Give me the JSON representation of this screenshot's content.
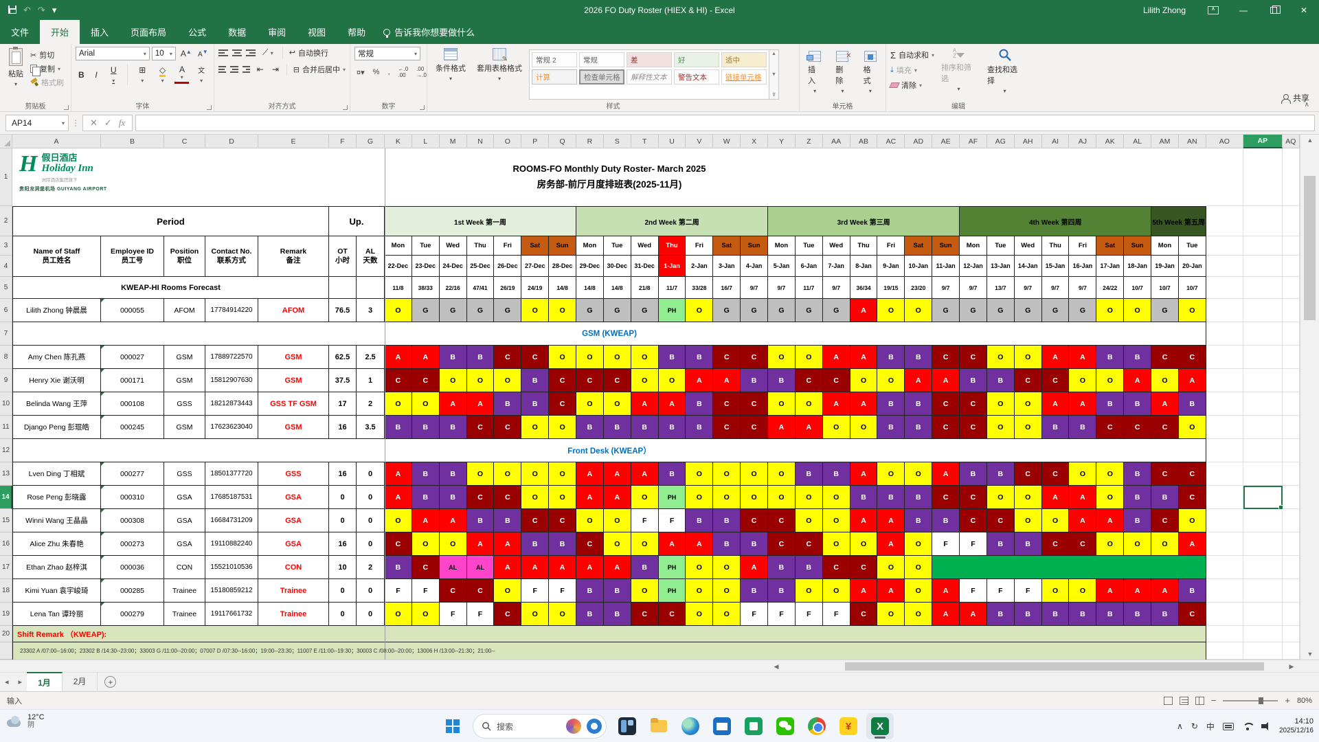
{
  "titlebar": {
    "title": "2026 FO Duty Roster (HIEX & HI)  -  Excel",
    "user": "Lilith Zhong"
  },
  "ribbon": {
    "file_tab": "文件",
    "tabs": [
      "开始",
      "插入",
      "页面布局",
      "公式",
      "数据",
      "审阅",
      "视图",
      "帮助"
    ],
    "active_tab": "开始",
    "tell_me": "告诉我你想要做什么",
    "share": "共享",
    "clipboard": {
      "label": "剪贴板",
      "paste": "粘贴",
      "cut": "剪切",
      "copy": "复制",
      "painter": "格式刷"
    },
    "font": {
      "label": "字体",
      "family": "Arial",
      "size": "10",
      "pinyin": "文"
    },
    "alignment": {
      "label": "对齐方式",
      "wrap": "自动换行",
      "merge": "合并后居中"
    },
    "number": {
      "label": "数字",
      "format": "常规"
    },
    "styles": {
      "label": "样式",
      "conditional": "条件格式",
      "format_table": "套用表格格式",
      "gallery": [
        "常规 2",
        "常规",
        "差",
        "好",
        "适中",
        "计算",
        "检查单元格",
        "解释性文本",
        "警告文本",
        "链接单元格"
      ]
    },
    "cells": {
      "label": "单元格",
      "insert": "插入",
      "delete": "删除",
      "format": "格式"
    },
    "editing": {
      "label": "编辑",
      "autosum": "自动求和",
      "fill": "填充",
      "clear": "清除",
      "sort": "排序和筛选",
      "find": "查找和选择"
    }
  },
  "formula_bar": {
    "name_box": "AP14",
    "formula": ""
  },
  "sheet": {
    "columns": [
      "A",
      "B",
      "C",
      "D",
      "E",
      "F",
      "G",
      "K",
      "L",
      "M",
      "N",
      "O",
      "P",
      "Q",
      "R",
      "S",
      "T",
      "U",
      "V",
      "W",
      "X",
      "Y",
      "Z",
      "AA",
      "AB",
      "AC",
      "AD",
      "AE",
      "AF",
      "AG",
      "AH",
      "AI",
      "AJ",
      "AK",
      "AL",
      "AM",
      "AN",
      "AO",
      "AP",
      "AQ"
    ],
    "selected_column": "AP",
    "selected_row": 14,
    "visible_rows": 20,
    "tabs": [
      "1月",
      "2月"
    ],
    "active_tab": "1月",
    "status_mode": "输入",
    "zoom": "80%"
  },
  "logo": {
    "mark": "H",
    "cn": "假日酒店",
    "en": "Holiday Inn",
    "sub": "洲际酒店集团旗下",
    "airport": "贵阳龙洞堡机场",
    "airport_en": "GUIYANG AIRPORT",
    "color": "#008c5a"
  },
  "roster": {
    "title_en": "ROOMS-FO Monthly Duty Roster- March 2025",
    "title_cn": "房务部-前厅月度排班表(2025-11月)",
    "period": "Period",
    "up": "Up.",
    "col_headers": [
      [
        "Name of Staff",
        "员工姓名"
      ],
      [
        "Employee ID",
        "员工号"
      ],
      [
        "Position",
        "职位"
      ],
      [
        "Contact No.",
        "联系方式"
      ],
      [
        "Remark",
        "备注"
      ],
      [
        "OT",
        "小时"
      ],
      [
        "AL",
        "天数"
      ]
    ],
    "weeks": [
      {
        "label": "1st Week 第一周",
        "span": 7,
        "bg": "#E2EFDA"
      },
      {
        "label": "2nd Week 第二周",
        "span": 7,
        "bg": "#C6E0B4"
      },
      {
        "label": "3rd Week 第三周",
        "span": 7,
        "bg": "#A9D08E"
      },
      {
        "label": "4th Week 第四周",
        "span": 7,
        "bg": "#548235"
      },
      {
        "label": "5th Week 第五周",
        "span": 2,
        "bg": "#375623"
      }
    ],
    "days": [
      "Mon",
      "Tue",
      "Wed",
      "Thu",
      "Fri",
      "Sat",
      "Sun",
      "Mon",
      "Tue",
      "Wed",
      "Thu",
      "Fri",
      "Sat",
      "Sun",
      "Mon",
      "Tue",
      "Wed",
      "Thu",
      "Fri",
      "Sat",
      "Sun",
      "Mon",
      "Tue",
      "Wed",
      "Thu",
      "Fri",
      "Sat",
      "Sun",
      "Mon",
      "Tue"
    ],
    "dates": [
      "22-Dec",
      "23-Dec",
      "24-Dec",
      "25-Dec",
      "26-Dec",
      "27-Dec",
      "28-Dec",
      "29-Dec",
      "30-Dec",
      "31-Dec",
      "1-Jan",
      "2-Jan",
      "3-Jan",
      "4-Jan",
      "5-Jan",
      "6-Jan",
      "7-Jan",
      "8-Jan",
      "9-Jan",
      "10-Jan",
      "11-Jan",
      "12-Jan",
      "13-Jan",
      "14-Jan",
      "15-Jan",
      "16-Jan",
      "17-Jan",
      "18-Jan",
      "19-Jan",
      "20-Jan"
    ],
    "day_types": [
      "w",
      "w",
      "w",
      "w",
      "w",
      "e",
      "e",
      "w",
      "w",
      "w",
      "h",
      "w",
      "e",
      "e",
      "w",
      "w",
      "w",
      "w",
      "w",
      "e",
      "e",
      "w",
      "w",
      "w",
      "w",
      "w",
      "e",
      "e",
      "w",
      "w"
    ],
    "day_colors": {
      "weekend": "#C55A11",
      "holiday": "#FF0000"
    },
    "forecast_label": "KWEAP-HI Rooms Forecast",
    "forecast": [
      "11/8",
      "38/33",
      "22/16",
      "47/41",
      "26/19",
      "24/19",
      "14/8",
      "14/8",
      "14/8",
      "21/8",
      "11/7",
      "33/28",
      "16/7",
      "9/7",
      "9/7",
      "11/7",
      "9/7",
      "36/34",
      "19/15",
      "23/20",
      "9/7",
      "9/7",
      "13/7",
      "9/7",
      "9/7",
      "9/7",
      "24/22",
      "10/7",
      "10/7",
      "10/7"
    ],
    "sections": {
      "gsm": "GSM (KWEAP)",
      "fd": "Front Desk (KWEAP）"
    },
    "staff": [
      {
        "name": "Lilith Zhong 钟晨晨",
        "id": "000055",
        "position": "AFOM",
        "contact": "17784914220",
        "remark": "AFOM",
        "ot": "76.5",
        "al": "3",
        "shifts": [
          "O",
          "G",
          "G",
          "G",
          "G",
          "O",
          "O",
          "G",
          "G",
          "G",
          "PH",
          "O",
          "G",
          "G",
          "G",
          "G",
          "G",
          "A",
          "O",
          "O",
          "G",
          "G",
          "G",
          "G",
          "G",
          "G",
          "O",
          "O",
          "G",
          "O"
        ]
      },
      {
        "name": "Amy Chen 陈孔燕",
        "id": "000027",
        "position": "GSM",
        "contact": "17889722570",
        "remark": "GSM",
        "ot": "62.5",
        "al": "2.5",
        "shifts": [
          "A",
          "A",
          "B",
          "B",
          "C",
          "C",
          "O",
          "O",
          "O",
          "O",
          "B",
          "B",
          "C",
          "C",
          "O",
          "O",
          "A",
          "A",
          "B",
          "B",
          "C",
          "C",
          "O",
          "O",
          "A",
          "A",
          "B",
          "B",
          "C",
          "C"
        ]
      },
      {
        "name": "Henry Xie 谢沃明",
        "id": "000171",
        "position": "GSM",
        "contact": "15812907630",
        "remark": "GSM",
        "ot": "37.5",
        "al": "1",
        "shifts": [
          "C",
          "C",
          "O",
          "O",
          "O",
          "B",
          "C",
          "C",
          "C",
          "O",
          "O",
          "A",
          "A",
          "B",
          "B",
          "C",
          "C",
          "O",
          "O",
          "A",
          "A",
          "B",
          "B",
          "C",
          "C",
          "O",
          "O",
          "A",
          "O",
          "A"
        ]
      },
      {
        "name": "Belinda Wang 王萍",
        "id": "000108",
        "position": "GSS",
        "contact": "18212873443",
        "remark": "GSS TF GSM",
        "ot": "17",
        "al": "2",
        "shifts": [
          "O",
          "O",
          "A",
          "A",
          "B",
          "B",
          "C",
          "O",
          "O",
          "A",
          "A",
          "B",
          "C",
          "C",
          "O",
          "O",
          "A",
          "A",
          "B",
          "B",
          "C",
          "C",
          "O",
          "O",
          "A",
          "A",
          "B",
          "B",
          "A",
          "B"
        ]
      },
      {
        "name": "Django Peng 彭琨皓",
        "id": "000245",
        "position": "GSM",
        "contact": "17623623040",
        "remark": "GSM",
        "ot": "16",
        "al": "3.5",
        "shifts": [
          "B",
          "B",
          "B",
          "C",
          "C",
          "O",
          "O",
          "B",
          "B",
          "B",
          "B",
          "B",
          "C",
          "C",
          "A",
          "A",
          "O",
          "O",
          "B",
          "B",
          "C",
          "C",
          "O",
          "O",
          "B",
          "B",
          "C",
          "C",
          "C",
          "O"
        ]
      },
      {
        "name": "Lven Ding 丁相斌",
        "id": "000277",
        "position": "GSS",
        "contact": "18501377720",
        "remark": "GSS",
        "ot": "16",
        "al": "0",
        "shifts": [
          "A",
          "B",
          "B",
          "O",
          "O",
          "O",
          "O",
          "A",
          "A",
          "A",
          "B",
          "O",
          "O",
          "O",
          "O",
          "B",
          "B",
          "A",
          "O",
          "O",
          "A",
          "B",
          "B",
          "C",
          "C",
          "O",
          "O",
          "B",
          "C",
          "C"
        ]
      },
      {
        "name": "Rose Peng 彭晓露",
        "id": "000310",
        "position": "GSA",
        "contact": "17685187531",
        "remark": "GSA",
        "ot": "0",
        "al": "0",
        "shifts": [
          "A",
          "B",
          "B",
          "C",
          "C",
          "O",
          "O",
          "A",
          "A",
          "O",
          "PH",
          "O",
          "O",
          "O",
          "O",
          "O",
          "O",
          "B",
          "B",
          "B",
          "C",
          "C",
          "O",
          "O",
          "A",
          "A",
          "O",
          "B",
          "B",
          "C"
        ]
      },
      {
        "name": "Winni Wang 王晶晶",
        "id": "000308",
        "position": "GSA",
        "contact": "16684731209",
        "remark": "GSA",
        "ot": "0",
        "al": "0",
        "shifts": [
          "O",
          "A",
          "A",
          "B",
          "B",
          "C",
          "C",
          "O",
          "O",
          "F",
          "F",
          "B",
          "B",
          "C",
          "C",
          "O",
          "O",
          "A",
          "A",
          "B",
          "B",
          "C",
          "C",
          "O",
          "O",
          "A",
          "A",
          "B",
          "C",
          "O"
        ]
      },
      {
        "name": "Alice Zhu 朱春艳",
        "id": "000273",
        "position": "GSA",
        "contact": "19110882240",
        "remark": "GSA",
        "ot": "16",
        "al": "0",
        "shifts": [
          "C",
          "O",
          "O",
          "A",
          "A",
          "B",
          "B",
          "C",
          "O",
          "O",
          "A",
          "A",
          "B",
          "B",
          "C",
          "C",
          "O",
          "O",
          "A",
          "O",
          "F",
          "F",
          "B",
          "B",
          "C",
          "C",
          "O",
          "O",
          "O",
          "A"
        ]
      },
      {
        "name": "Ethan Zhao 赵梓淇",
        "id": "000036",
        "position": "CON",
        "contact": "15521010536",
        "remark": "CON",
        "ot": "10",
        "al": "2",
        "shifts": [
          "B",
          "C",
          "AL",
          "AL",
          "A",
          "A",
          "A",
          "A",
          "A",
          "B",
          "PH",
          "O",
          "O",
          "A",
          "B",
          "B",
          "C",
          "C",
          "O",
          "O"
        ],
        "leave_block": 10
      },
      {
        "name": "Kimi Yuan 袁宇峻琦",
        "id": "000285",
        "position": "Trainee",
        "contact": "15180859212",
        "remark": "Trainee",
        "ot": "0",
        "al": "0",
        "shifts": [
          "F",
          "F",
          "C",
          "C",
          "O",
          "F",
          "F",
          "B",
          "B",
          "O",
          "PH",
          "O",
          "O",
          "B",
          "B",
          "O",
          "O",
          "A",
          "A",
          "O",
          "A",
          "F",
          "F",
          "F",
          "O",
          "O",
          "A",
          "A",
          "A",
          "B"
        ]
      },
      {
        "name": "Lena Tan 谭玲丽",
        "id": "000279",
        "position": "Trainee",
        "contact": "19117661732",
        "remark": "Trainee",
        "ot": "0",
        "al": "0",
        "shifts": [
          "O",
          "O",
          "F",
          "F",
          "C",
          "O",
          "O",
          "B",
          "B",
          "C",
          "C",
          "O",
          "O",
          "F",
          "F",
          "F",
          "F",
          "C",
          "O",
          "O",
          "A",
          "A",
          "B",
          "B",
          "B",
          "B",
          "B",
          "B",
          "B",
          "C"
        ]
      }
    ],
    "shift_styles": {
      "O": {
        "bg": "#FFFF00",
        "fg": "#000000"
      },
      "G": {
        "bg": "#BFBFBF",
        "fg": "#000000"
      },
      "A": {
        "bg": "#FF0000",
        "fg": "#FFFFFF"
      },
      "B": {
        "bg": "#7030A0",
        "fg": "#FFFFFF"
      },
      "C": {
        "bg": "#9B0000",
        "fg": "#FFFFFF"
      },
      "PH": {
        "bg": "#90EE90",
        "fg": "#000000"
      },
      "AL": {
        "bg": "#FF44CC",
        "fg": "#000000"
      },
      "F": {
        "bg": "#FFFFFF",
        "fg": "#000000"
      }
    },
    "leave_block_color": "#00B050",
    "remark_bg": "#D8E4BC",
    "remark_title": "Shift Remark （KWEAP):",
    "remark_detail": "23302 A /07:00--16:00；23302 B /14:30--23:00；33003 G /11:00--20:00；07007 D /07:30--16:00；19:00--23:30；11007 E /11:00--19:30；30003 C /08:00--20:00；13006 H /13:00--21:30；21:00--"
  },
  "taskbar": {
    "search": "搜索",
    "weather": {
      "temp": "12°C",
      "cond": "阴"
    },
    "apps": [
      "task-view",
      "file-explorer",
      "edge",
      "mail-app",
      "store-app",
      "wechat",
      "chrome",
      "finance-app",
      "excel"
    ],
    "active_app": "excel",
    "excel_glyph": "X",
    "finance_glyph": "¥",
    "tray": {
      "ime": "中",
      "time": "14:10",
      "date": "2025/12/16"
    }
  }
}
